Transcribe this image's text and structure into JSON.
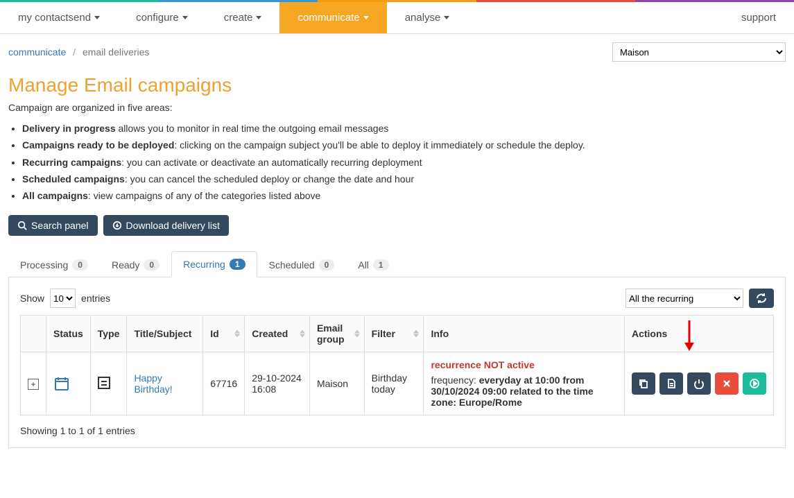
{
  "stripes": [
    "#1abc9c",
    "#3498db",
    "#e67e22",
    "#c0392b",
    "#8e44ad"
  ],
  "nav": {
    "items": [
      {
        "label": "my contactsend",
        "active": false,
        "caret": true
      },
      {
        "label": "configure",
        "active": false,
        "caret": true
      },
      {
        "label": "create",
        "active": false,
        "caret": true
      },
      {
        "label": "communicate",
        "active": true,
        "caret": true
      },
      {
        "label": "analyse",
        "active": false,
        "caret": true
      }
    ],
    "support": "support"
  },
  "breadcrumb": {
    "root": "communicate",
    "current": "email deliveries"
  },
  "db_select": {
    "selected": "Maison"
  },
  "page": {
    "title": "Manage Email campaigns",
    "subtitle": "Campaign are organized in five areas:",
    "bullets": [
      {
        "b": "Delivery in progress",
        "rest": " allows you to monitor in real time the outgoing email messages"
      },
      {
        "b": "Campaigns ready to be deployed",
        "rest": ": clicking on the campaign subject you'll be able to deploy it immediately or schedule the deploy."
      },
      {
        "b": "Recurring campaigns",
        "rest": ": you can activate or deactivate an automatically recurring deployment"
      },
      {
        "b": "Scheduled campaigns",
        "rest": ": you can cancel the scheduled deploy or change the date and hour"
      },
      {
        "b": "All campaigns",
        "rest": ": view campaigns of any of the categories listed above"
      }
    ]
  },
  "buttons": {
    "search": "Search panel",
    "download": "Download delivery list"
  },
  "tabs": [
    {
      "label": "Processing",
      "count": "0",
      "active": false
    },
    {
      "label": "Ready",
      "count": "0",
      "active": false
    },
    {
      "label": "Recurring",
      "count": "1",
      "active": true
    },
    {
      "label": "Scheduled",
      "count": "0",
      "active": false
    },
    {
      "label": "All",
      "count": "1",
      "active": false
    }
  ],
  "table_controls": {
    "show_label_pre": "Show",
    "show_label_post": "entries",
    "page_size": "10",
    "filter_selected": "All the recurring"
  },
  "columns": [
    "",
    "Status",
    "Type",
    "Title/Subject",
    "Id",
    "Created",
    "Email group",
    "Filter",
    "Info",
    "Actions"
  ],
  "row": {
    "title": "Happy Birthday!",
    "id": "67716",
    "created": "29-10-2024 16:08",
    "group": "Maison",
    "filter": "Birthday today",
    "info_warning": "recurrence NOT active",
    "info_freq_label": "frequency: ",
    "info_freq_value": "everyday at 10:00 from 30/10/2024 09:00 related to the time zone: Europe/Rome"
  },
  "footer": "Showing 1 to 1 of 1 entries"
}
